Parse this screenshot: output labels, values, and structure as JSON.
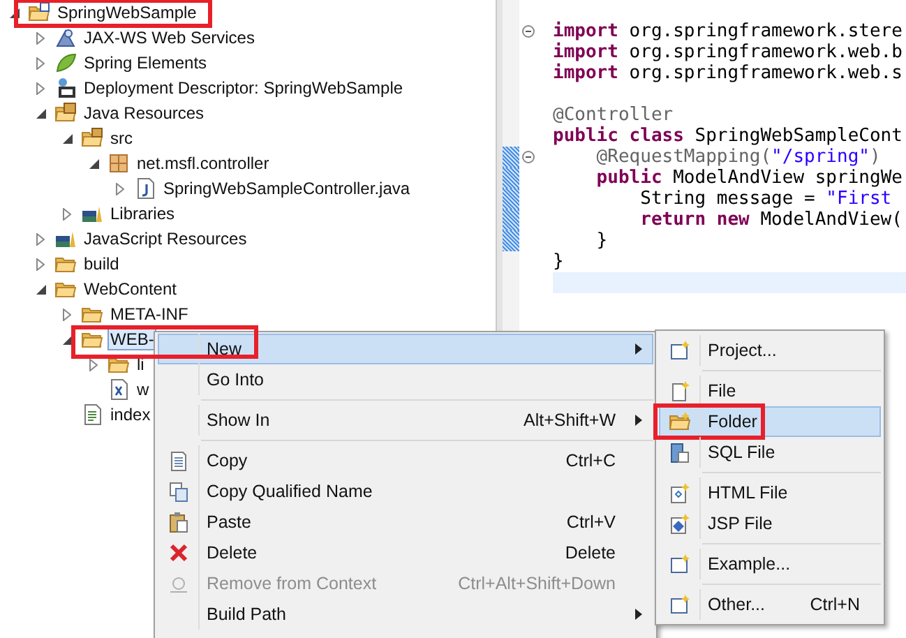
{
  "project_explorer": {
    "items": [
      {
        "label": "SpringWebSample",
        "kind": "project",
        "expanded": true,
        "selected": false,
        "annotated": true,
        "children": [
          {
            "label": "JAX-WS Web Services",
            "kind": "services",
            "expanded": false,
            "selected": false
          },
          {
            "label": "Spring Elements",
            "kind": "spring",
            "expanded": false,
            "selected": false
          },
          {
            "label": "Deployment Descriptor: SpringWebSample",
            "kind": "descriptor",
            "expanded": false,
            "selected": false
          },
          {
            "label": "Java Resources",
            "kind": "resources",
            "expanded": true,
            "selected": false,
            "children": [
              {
                "label": "src",
                "kind": "source",
                "expanded": true,
                "selected": false,
                "children": [
                  {
                    "label": "net.msfl.controller",
                    "kind": "package",
                    "expanded": true,
                    "selected": false,
                    "children": [
                      {
                        "label": "SpringWebSampleController.java",
                        "kind": "java",
                        "expanded": false,
                        "selected": false
                      }
                    ]
                  }
                ]
              },
              {
                "label": "Libraries",
                "kind": "library",
                "expanded": false,
                "selected": false
              }
            ]
          },
          {
            "label": "JavaScript Resources",
            "kind": "library",
            "expanded": false,
            "selected": false
          },
          {
            "label": "build",
            "kind": "folder",
            "expanded": false,
            "selected": false
          },
          {
            "label": "WebContent",
            "kind": "folder",
            "expanded": true,
            "selected": false,
            "children": [
              {
                "label": "META-INF",
                "kind": "folder",
                "expanded": false,
                "selected": false
              },
              {
                "label": "WEB-",
                "kind": "folder",
                "expanded": true,
                "selected": true,
                "children": [
                  {
                    "label": "li",
                    "kind": "folder",
                    "expanded": false,
                    "selected": false
                  },
                  {
                    "label": "w",
                    "kind": "xml",
                    "selected": false
                  }
                ]
              },
              {
                "label": "index",
                "kind": "file",
                "selected": false
              }
            ]
          }
        ]
      }
    ]
  },
  "editor": {
    "lines": [
      {
        "kind": "blank"
      },
      {
        "kind": "code",
        "tokens": [
          {
            "kind": "keyword",
            "text": "import"
          },
          {
            "kind": "plain",
            "text": " org.springframework.stere"
          }
        ],
        "current": false,
        "changed": false,
        "foldable": true
      },
      {
        "kind": "code",
        "tokens": [
          {
            "kind": "keyword",
            "text": "import"
          },
          {
            "kind": "plain",
            "text": " org.springframework.web.b"
          }
        ],
        "current": false,
        "changed": false,
        "foldable": false
      },
      {
        "kind": "code",
        "tokens": [
          {
            "kind": "keyword",
            "text": "import"
          },
          {
            "kind": "plain",
            "text": " org.springframework.web.s"
          }
        ],
        "current": false,
        "changed": false,
        "foldable": false
      },
      {
        "kind": "blank"
      },
      {
        "kind": "code",
        "tokens": [
          {
            "kind": "annotation",
            "text": "@Controller"
          }
        ],
        "current": false,
        "changed": false,
        "foldable": false
      },
      {
        "kind": "code",
        "tokens": [
          {
            "kind": "keyword",
            "text": "public class"
          },
          {
            "kind": "plain",
            "text": " SpringWebSampleCont"
          }
        ],
        "current": false,
        "changed": false,
        "foldable": false
      },
      {
        "kind": "code",
        "tokens": [
          {
            "kind": "annotation",
            "text": "    @RequestMapping("
          },
          {
            "kind": "string",
            "text": "\"/spring\""
          },
          {
            "kind": "annotation",
            "text": ")"
          }
        ],
        "current": false,
        "changed": true,
        "foldable": true
      },
      {
        "kind": "code",
        "tokens": [
          {
            "kind": "keyword",
            "text": "    public"
          },
          {
            "kind": "plain",
            "text": " ModelAndView springWe"
          }
        ],
        "current": false,
        "changed": true,
        "foldable": false
      },
      {
        "kind": "code",
        "tokens": [
          {
            "kind": "plain",
            "text": "        String message = "
          },
          {
            "kind": "string",
            "text": "\"First"
          }
        ],
        "current": false,
        "changed": true,
        "foldable": false
      },
      {
        "kind": "code",
        "tokens": [
          {
            "kind": "keyword",
            "text": "        return new"
          },
          {
            "kind": "plain",
            "text": " ModelAndView("
          }
        ],
        "current": false,
        "changed": true,
        "foldable": false
      },
      {
        "kind": "code",
        "tokens": [
          {
            "kind": "plain",
            "text": "    }"
          }
        ],
        "current": false,
        "changed": true,
        "foldable": false
      },
      {
        "kind": "code",
        "tokens": [
          {
            "kind": "plain",
            "text": "}"
          }
        ],
        "current": false,
        "changed": false,
        "foldable": false
      },
      {
        "kind": "blank",
        "current": true
      }
    ]
  },
  "context_menu": {
    "items": [
      {
        "kind": "plain",
        "label": "New",
        "submenu": true,
        "selected": true,
        "disabled": false,
        "annotated": true
      },
      {
        "kind": "plain",
        "label": "Go Into",
        "submenu": false,
        "selected": false,
        "disabled": false
      },
      {
        "kind": "separator"
      },
      {
        "kind": "plain",
        "label": "Show In",
        "shortcut": "Alt+Shift+W",
        "submenu": true,
        "selected": false,
        "disabled": false
      },
      {
        "kind": "separator"
      },
      {
        "kind": "copy",
        "label": "Copy",
        "shortcut": "Ctrl+C",
        "submenu": false,
        "selected": false,
        "disabled": false
      },
      {
        "kind": "copy-name",
        "label": "Copy Qualified Name",
        "submenu": false,
        "selected": false,
        "disabled": false
      },
      {
        "kind": "paste",
        "label": "Paste",
        "shortcut": "Ctrl+V",
        "submenu": false,
        "selected": false,
        "disabled": false
      },
      {
        "kind": "delete",
        "label": "Delete",
        "shortcut": "Delete",
        "submenu": false,
        "selected": false,
        "disabled": false
      },
      {
        "kind": "remove",
        "label": "Remove from Context",
        "shortcut": "Ctrl+Alt+Shift+Down",
        "submenu": false,
        "selected": false,
        "disabled": true
      },
      {
        "kind": "plain",
        "label": "Build Path",
        "submenu": true,
        "selected": false,
        "disabled": false
      }
    ]
  },
  "new_submenu": {
    "items": [
      {
        "kind": "wizard",
        "label": "Project...",
        "selected": false
      },
      {
        "kind": "separator"
      },
      {
        "kind": "file",
        "label": "File",
        "selected": false
      },
      {
        "kind": "folder",
        "label": "Folder",
        "selected": true,
        "annotated": true
      },
      {
        "kind": "sql",
        "label": "SQL File",
        "selected": false
      },
      {
        "kind": "separator"
      },
      {
        "kind": "html",
        "label": "HTML File",
        "selected": false
      },
      {
        "kind": "jsp",
        "label": "JSP File",
        "selected": false
      },
      {
        "kind": "separator"
      },
      {
        "kind": "wizard",
        "label": "Example...",
        "selected": false
      },
      {
        "kind": "separator"
      },
      {
        "kind": "wizard",
        "label": "Other...",
        "shortcut": "Ctrl+N",
        "selected": false
      }
    ]
  }
}
